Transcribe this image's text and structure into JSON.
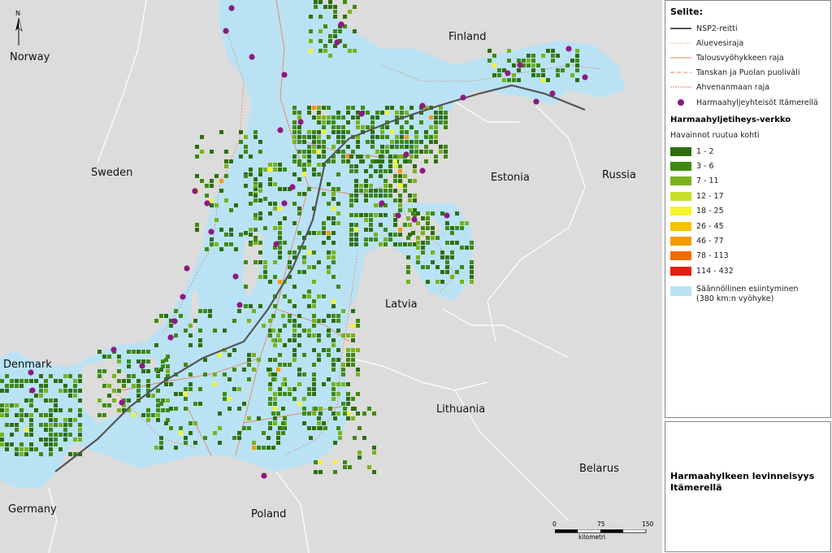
{
  "countries": [
    {
      "name": "Finland",
      "key": "finland"
    },
    {
      "name": "Norway",
      "key": "norway"
    },
    {
      "name": "Sweden",
      "key": "sweden"
    },
    {
      "name": "Estonia",
      "key": "estonia"
    },
    {
      "name": "Russia",
      "key": "russia"
    },
    {
      "name": "Latvia",
      "key": "latvia"
    },
    {
      "name": "Denmark",
      "key": "denmark"
    },
    {
      "name": "Lithuania",
      "key": "lithuania"
    },
    {
      "name": "Belarus",
      "key": "belarus"
    },
    {
      "name": "Germany",
      "key": "germany"
    },
    {
      "name": "Poland",
      "key": "poland"
    }
  ],
  "north_label": "N",
  "legend": {
    "title": "Selite:",
    "lines": [
      {
        "label": "NSP2-reitti",
        "style": "solid-dark",
        "color": "#555555"
      },
      {
        "label": "Aluevesiraja",
        "style": "dotted",
        "color": "#e8825a"
      },
      {
        "label": "Talousvyöhykkeen raja",
        "style": "solid-thin",
        "color": "#e8825a"
      },
      {
        "label": "Tanskan ja Puolan puoliväli",
        "style": "dashed",
        "color": "#e8825a"
      },
      {
        "label": "Ahvenanmaan raja",
        "style": "dotted-dense",
        "color": "#e8825a"
      }
    ],
    "colonies": {
      "label": "Harmaahyljeyhteisöt Itämerellä",
      "color": "#8e1a7e"
    },
    "grid_title": "Harmaahyljetiheys-verkko",
    "grid_subtitle": "Havainnot ruutua kohti",
    "classes": [
      {
        "label": "1 - 2",
        "color": "#2e6e0e"
      },
      {
        "label": "3 - 6",
        "color": "#3e8a12"
      },
      {
        "label": "7 - 11",
        "color": "#79b21c"
      },
      {
        "label": "12 - 17",
        "color": "#c6e02a"
      },
      {
        "label": "18 - 25",
        "color": "#f5f52a"
      },
      {
        "label": "26 - 45",
        "color": "#f5c200"
      },
      {
        "label": "46 - 77",
        "color": "#f59a00"
      },
      {
        "label": "78 - 113",
        "color": "#f56a00"
      },
      {
        "label": "114 - 432",
        "color": "#e81b10"
      }
    ],
    "occurrence": {
      "label_line1": "Säännöllinen esiintyminen",
      "label_line2": "(380 km:n vyöhyke)",
      "color": "#b9e3f5"
    }
  },
  "map_title": "Harmaahylkeen levinneisyys Itämerellä",
  "scalebar": {
    "ticks": [
      "0",
      "75",
      "150"
    ],
    "unit": "kilometri"
  },
  "colors": {
    "land": "#dcdcdc",
    "sea": "#b9e3f5",
    "borders": "#ffffff",
    "route": "#555555",
    "colony": "#8e1a7e"
  }
}
